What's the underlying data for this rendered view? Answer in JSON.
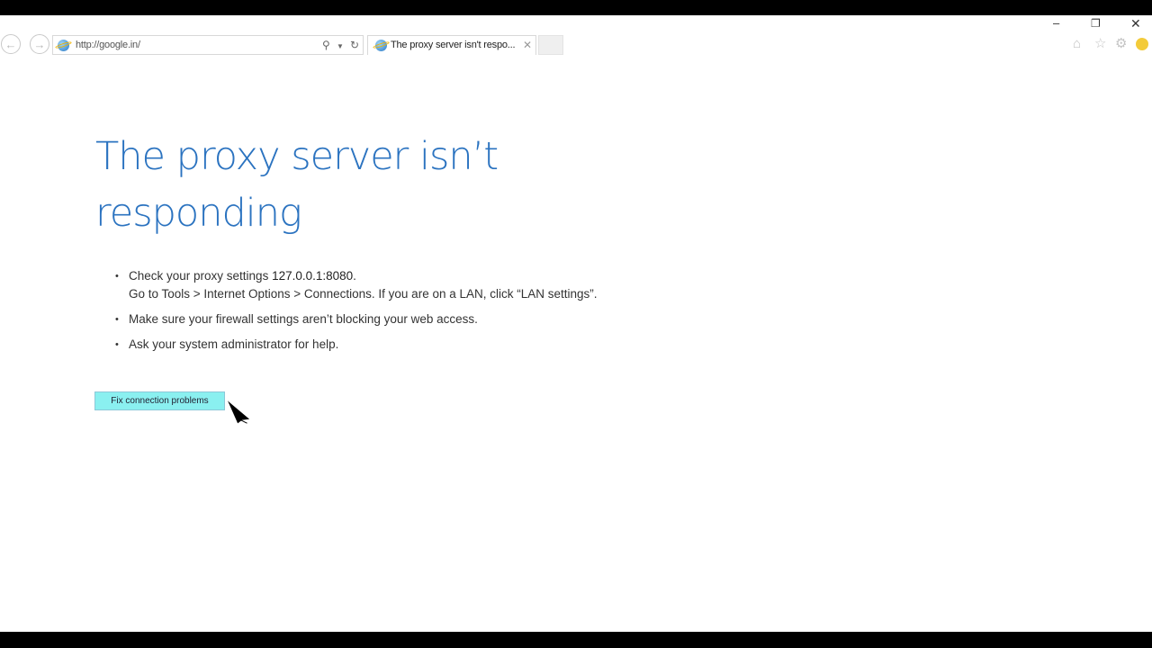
{
  "browser": {
    "url": "http://google.in/",
    "tab_title": "The proxy server isn't respo...",
    "icons": {
      "back": "back-arrow-icon",
      "forward": "forward-arrow-icon",
      "search": "search-icon",
      "refresh": "refresh-icon",
      "tab_close": "close-icon",
      "home": "home-icon",
      "favorites": "star-icon",
      "tools": "gear-icon",
      "feedback": "smiley-icon"
    }
  },
  "window_controls": {
    "minimize": "–",
    "restore": "❐",
    "close": "✕"
  },
  "page": {
    "title": "The proxy server isn’t responding",
    "suggestions": {
      "proxy_prefix": "Check your proxy settings ",
      "proxy_value": "127.0.0.1:8080",
      "proxy_period": ".",
      "proxy_path": "Go to Tools > Internet Options > Connections. If you are on a LAN, click “LAN settings”.",
      "firewall": "Make sure your firewall settings aren’t blocking your web access.",
      "admin": "Ask your system administrator for help."
    },
    "fix_button_label": "Fix connection problems"
  },
  "colors": {
    "title": "#2b73c0",
    "button_bg": "#8af0f0",
    "letterbox": "#000000"
  }
}
